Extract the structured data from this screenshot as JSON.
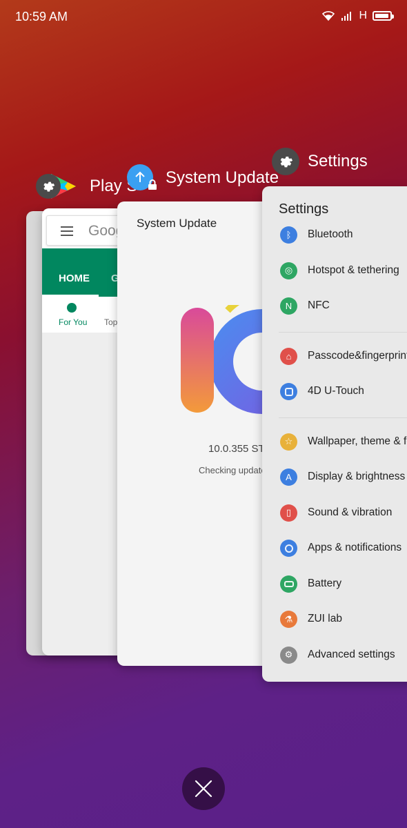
{
  "status_bar": {
    "time": "10:59 AM",
    "network": "H"
  },
  "apps": {
    "playstore": {
      "title": "Play S",
      "search_text": "Goog",
      "tab_home": "HOME",
      "tab_next": "G",
      "sub_for_you": "For You",
      "sub_top": "Top",
      "accent": "#01875f"
    },
    "system_update": {
      "title": "System Update",
      "header": "System Update",
      "version": "10.0.355 ST",
      "status": "Checking update"
    },
    "settings": {
      "title": "Settings",
      "heading": "Settings",
      "groups": [
        [
          {
            "label": "Bluetooth",
            "color": "#3d7fe0",
            "icon": "bluetooth-icon"
          },
          {
            "label": "Hotspot & tethering",
            "color": "#2ea663",
            "icon": "hotspot-icon"
          },
          {
            "label": "NFC",
            "color": "#2ea663",
            "icon": "nfc-icon"
          }
        ],
        [
          {
            "label": "Passcode&fingerprint",
            "color": "#e0504a",
            "icon": "lock-icon"
          },
          {
            "label": "4D U-Touch",
            "color": "#3d7fe0",
            "icon": "utouch-icon"
          }
        ],
        [
          {
            "label": "Wallpaper, theme & fo",
            "color": "#e8b13a",
            "icon": "star-icon"
          },
          {
            "label": "Display & brightness",
            "color": "#3d7fe0",
            "icon": "display-icon"
          },
          {
            "label": "Sound & vibration",
            "color": "#e0504a",
            "icon": "vibration-icon"
          },
          {
            "label": "Apps & notifications",
            "color": "#3d7fe0",
            "icon": "apps-icon"
          },
          {
            "label": "Battery",
            "color": "#2ea663",
            "icon": "battery-icon"
          },
          {
            "label": "ZUI lab",
            "color": "#e8793a",
            "icon": "flask-icon"
          },
          {
            "label": "Advanced settings",
            "color": "#8a8a8a",
            "icon": "gear-icon"
          }
        ]
      ]
    }
  }
}
